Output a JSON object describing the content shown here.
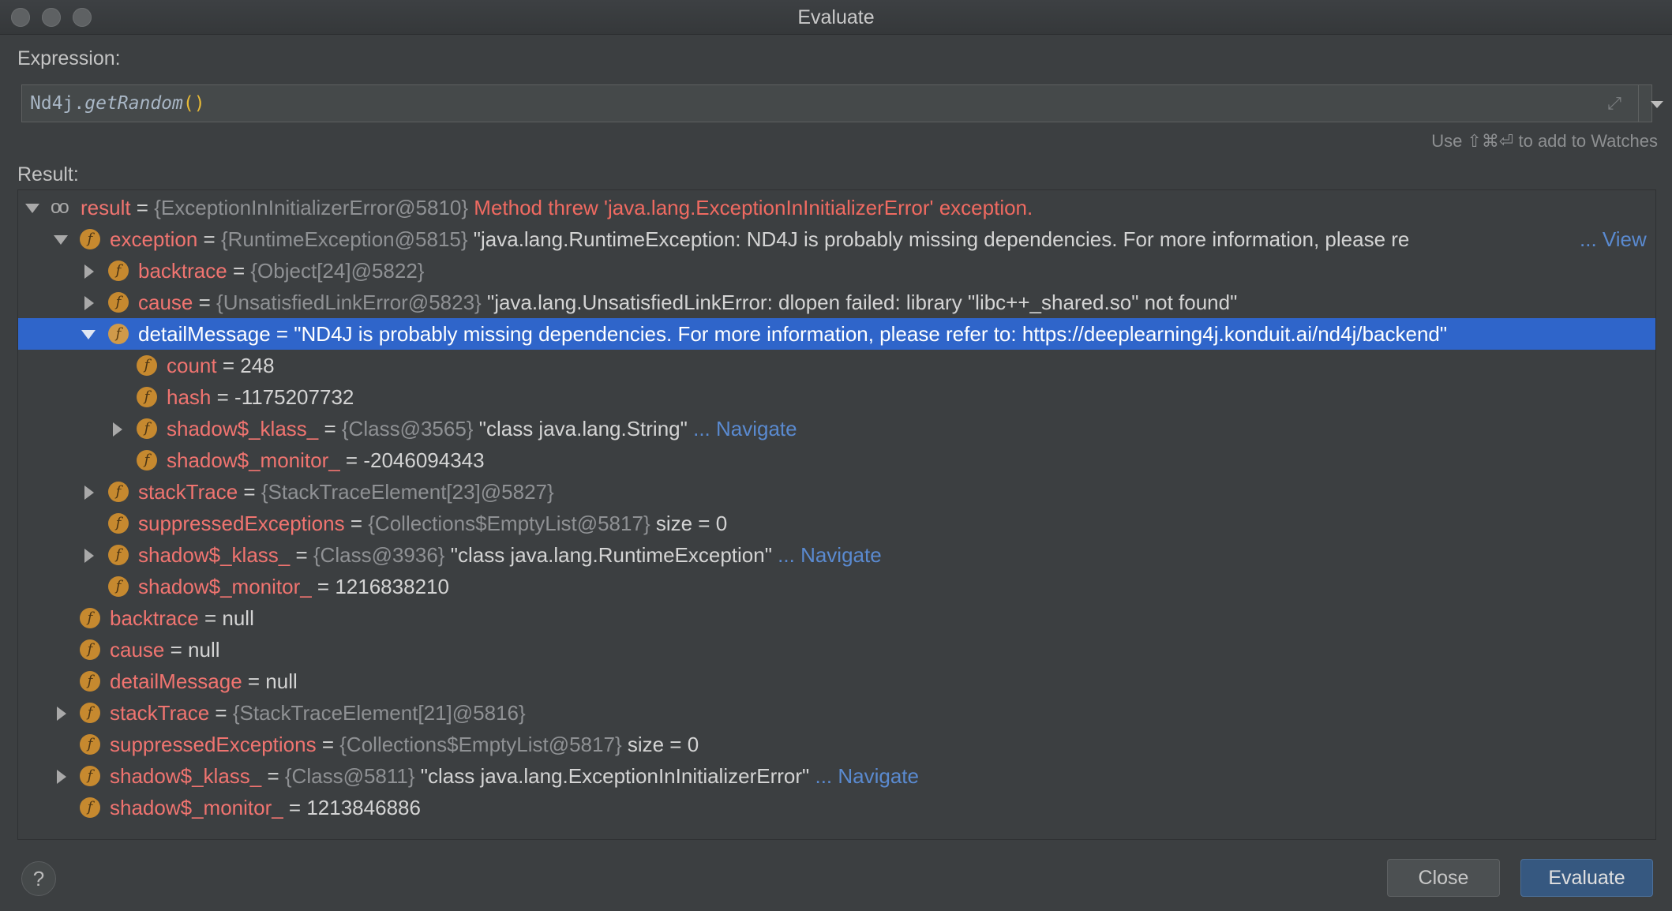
{
  "window": {
    "title": "Evaluate"
  },
  "expression": {
    "label": "Expression:",
    "value_prefix": "Nd4j.",
    "value_method": "getRandom",
    "value_parens": "()",
    "hint": "Use ⇧⌘⏎ to add to Watches"
  },
  "result": {
    "label": "Result:",
    "rows": [
      {
        "name": "result",
        "eq": " = ",
        "type": "{ExceptionInInitializerError@5810}",
        "value": "",
        "error": " Method threw 'java.lang.ExceptionInInitializerError' exception.",
        "action": ""
      },
      {
        "name": "exception",
        "eq": " = ",
        "type": "{RuntimeException@5815}",
        "value": " \"java.lang.RuntimeException: ND4J is probably missing dependencies. For more information, please re",
        "error": "",
        "action": "... View"
      },
      {
        "name": "backtrace",
        "eq": " = ",
        "type": "{Object[24]@5822}",
        "value": "",
        "error": "",
        "action": ""
      },
      {
        "name": "cause",
        "eq": " = ",
        "type": "{UnsatisfiedLinkError@5823}",
        "value": " \"java.lang.UnsatisfiedLinkError: dlopen failed: library \"libc++_shared.so\" not found\"",
        "error": "",
        "action": ""
      },
      {
        "name": "detailMessage",
        "eq": " = ",
        "type": "",
        "value": "\"ND4J is probably missing dependencies. For more information, please refer to: https://deeplearning4j.konduit.ai/nd4j/backend\"",
        "error": "",
        "action": ""
      },
      {
        "name": "count",
        "eq": " = ",
        "type": "",
        "value": "248",
        "error": "",
        "action": ""
      },
      {
        "name": "hash",
        "eq": " = ",
        "type": "",
        "value": "-1175207732",
        "error": "",
        "action": ""
      },
      {
        "name": "shadow$_klass_",
        "eq": " = ",
        "type": "{Class@3565}",
        "value": " \"class java.lang.String\"",
        "error": "",
        "action": " ... Navigate"
      },
      {
        "name": "shadow$_monitor_",
        "eq": " = ",
        "type": "",
        "value": "-2046094343",
        "error": "",
        "action": ""
      },
      {
        "name": "stackTrace",
        "eq": " = ",
        "type": "{StackTraceElement[23]@5827}",
        "value": "",
        "error": "",
        "action": ""
      },
      {
        "name": "suppressedExceptions",
        "eq": " = ",
        "type": "{Collections$EmptyList@5817}",
        "value": "  size = 0",
        "error": "",
        "action": ""
      },
      {
        "name": "shadow$_klass_",
        "eq": " = ",
        "type": "{Class@3936}",
        "value": " \"class java.lang.RuntimeException\"",
        "error": "",
        "action": " ... Navigate"
      },
      {
        "name": "shadow$_monitor_",
        "eq": " = ",
        "type": "",
        "value": "1216838210",
        "error": "",
        "action": ""
      },
      {
        "name": "backtrace",
        "eq": " = ",
        "type": "",
        "value": "null",
        "error": "",
        "action": ""
      },
      {
        "name": "cause",
        "eq": " = ",
        "type": "",
        "value": "null",
        "error": "",
        "action": ""
      },
      {
        "name": "detailMessage",
        "eq": " = ",
        "type": "",
        "value": "null",
        "error": "",
        "action": ""
      },
      {
        "name": "stackTrace",
        "eq": " = ",
        "type": "{StackTraceElement[21]@5816}",
        "value": "",
        "error": "",
        "action": ""
      },
      {
        "name": "suppressedExceptions",
        "eq": " = ",
        "type": "{Collections$EmptyList@5817}",
        "value": "  size = 0",
        "error": "",
        "action": ""
      },
      {
        "name": "shadow$_klass_",
        "eq": " = ",
        "type": "{Class@5811}",
        "value": " \"class java.lang.ExceptionInInitializerError\"",
        "error": "",
        "action": " ... Navigate"
      },
      {
        "name": "shadow$_monitor_",
        "eq": " = ",
        "type": "",
        "value": "1213846886",
        "error": "",
        "action": ""
      }
    ]
  },
  "icons": {
    "field": "f",
    "watch": "oo",
    "help": "?"
  },
  "buttons": {
    "close": "Close",
    "evaluate": "Evaluate"
  }
}
